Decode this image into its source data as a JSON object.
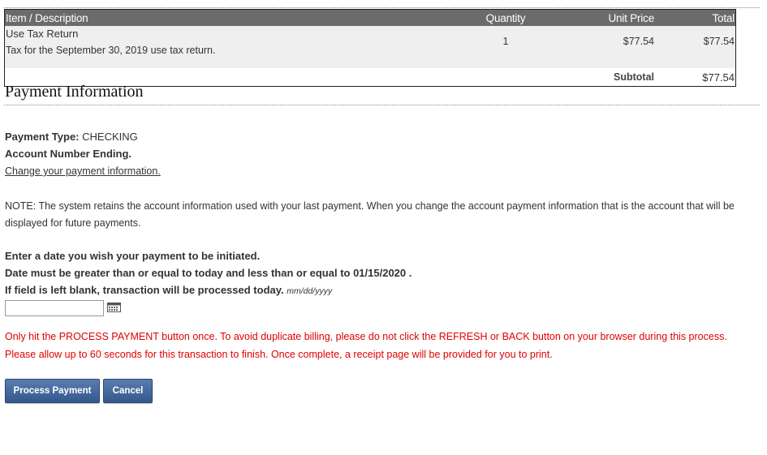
{
  "order_table": {
    "headers": {
      "description": "Item / Description",
      "quantity": "Quantity",
      "unit_price": "Unit Price",
      "total": "Total"
    },
    "items": [
      {
        "name": "Use Tax Return",
        "description": "Tax for the September 30, 2019 use tax return.",
        "quantity": "1",
        "unit_price": "$77.54",
        "total": "$77.54"
      }
    ],
    "subtotal_label": "Subtotal",
    "subtotal_value": "$77.54"
  },
  "payment_info": {
    "title": "Payment Information",
    "payment_type_label": "Payment Type:",
    "payment_type_value": "CHECKING",
    "account_number_label": "Account Number Ending.",
    "change_link": "Change your payment information.",
    "note": "NOTE: The system retains the account information used with your last payment. When you change the account payment information that is the account that will be displayed for future payments."
  },
  "date_section": {
    "line1": "Enter a date you wish your payment to be initiated.",
    "line2": "Date must be greater than or equal to today and less than or equal to 01/15/2020 .",
    "line3": "If field is left blank, transaction will be processed today.",
    "format_hint": "mm/dd/yyyy",
    "input_value": "",
    "calendar_icon": "calendar-icon"
  },
  "warning": {
    "line1": "Only hit the PROCESS PAYMENT button once. To avoid duplicate billing, please do not click the REFRESH or BACK button on your browser during this process.",
    "line2": "Please allow up to 60 seconds for this transaction to finish. Once complete, a receipt page will be provided for you to print.",
    "color": "#e00000"
  },
  "buttons": {
    "process": "Process Payment",
    "cancel": "Cancel",
    "color": "#3d6198"
  },
  "colors": {
    "table_header": "#6b6b6b",
    "item_row": "#efefef"
  }
}
